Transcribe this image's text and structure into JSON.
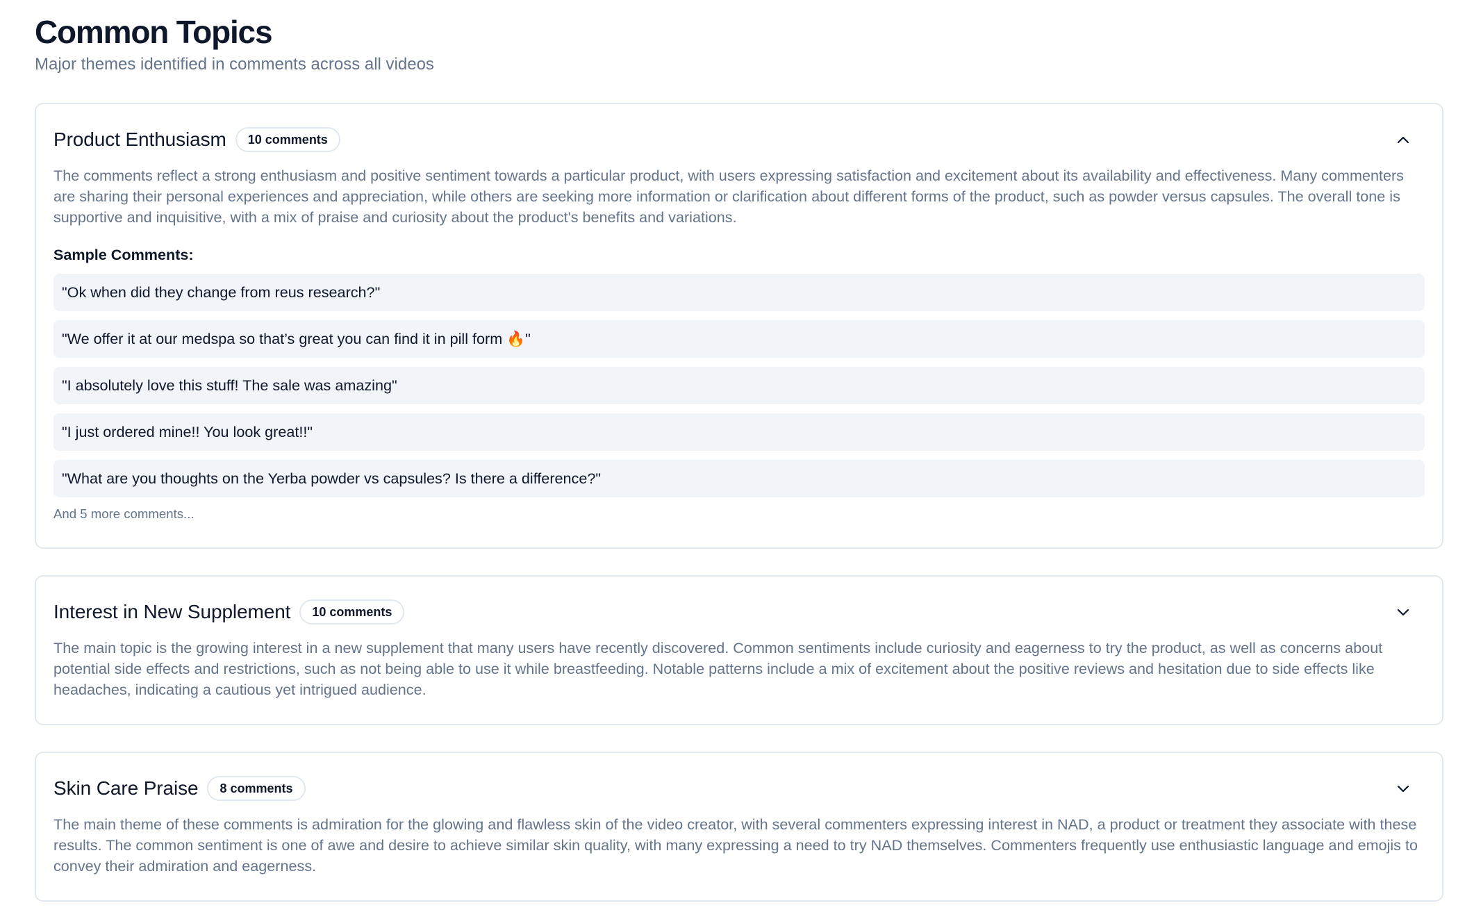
{
  "header": {
    "title": "Common Topics",
    "subtitle": "Major themes identified in comments across all videos"
  },
  "topics": [
    {
      "title": "Product Enthusiasm",
      "count_label": "10 comments",
      "expanded": true,
      "chevron_icon": "chevron-up-icon",
      "description": "The comments reflect a strong enthusiasm and positive sentiment towards a particular product, with users expressing satisfaction and excitement about its availability and effectiveness. Many commenters are sharing their personal experiences and appreciation, while others are seeking more information or clarification about different forms of the product, such as powder versus capsules. The overall tone is supportive and inquisitive, with a mix of praise and curiosity about the product's benefits and variations.",
      "samples_label": "Sample Comments:",
      "samples": [
        "\"Ok when did they change from reus research?\"",
        "\"We offer it at our medspa so that’s great you can find it in pill form 🔥\"",
        "\"I absolutely love this stuff! The sale was amazing\"",
        "\"I just ordered mine!! You look great!!\"",
        "\"What are you thoughts on the Yerba powder vs capsules? Is there a difference?\""
      ],
      "more_label": "And 5 more comments..."
    },
    {
      "title": "Interest in New Supplement",
      "count_label": "10 comments",
      "expanded": false,
      "chevron_icon": "chevron-down-icon",
      "description": "The main topic is the growing interest in a new supplement that many users have recently discovered. Common sentiments include curiosity and eagerness to try the product, as well as concerns about potential side effects and restrictions, such as not being able to use it while breastfeeding. Notable patterns include a mix of excitement about the positive reviews and hesitation due to side effects like headaches, indicating a cautious yet intrigued audience."
    },
    {
      "title": "Skin Care Praise",
      "count_label": "8 comments",
      "expanded": false,
      "chevron_icon": "chevron-down-icon",
      "description": "The main theme of these comments is admiration for the glowing and flawless skin of the video creator, with several commenters expressing interest in NAD, a product or treatment they associate with these results. The common sentiment is one of awe and desire to achieve similar skin quality, with many expressing a need to try NAD themselves. Commenters frequently use enthusiastic language and emojis to convey their admiration and eagerness."
    }
  ]
}
